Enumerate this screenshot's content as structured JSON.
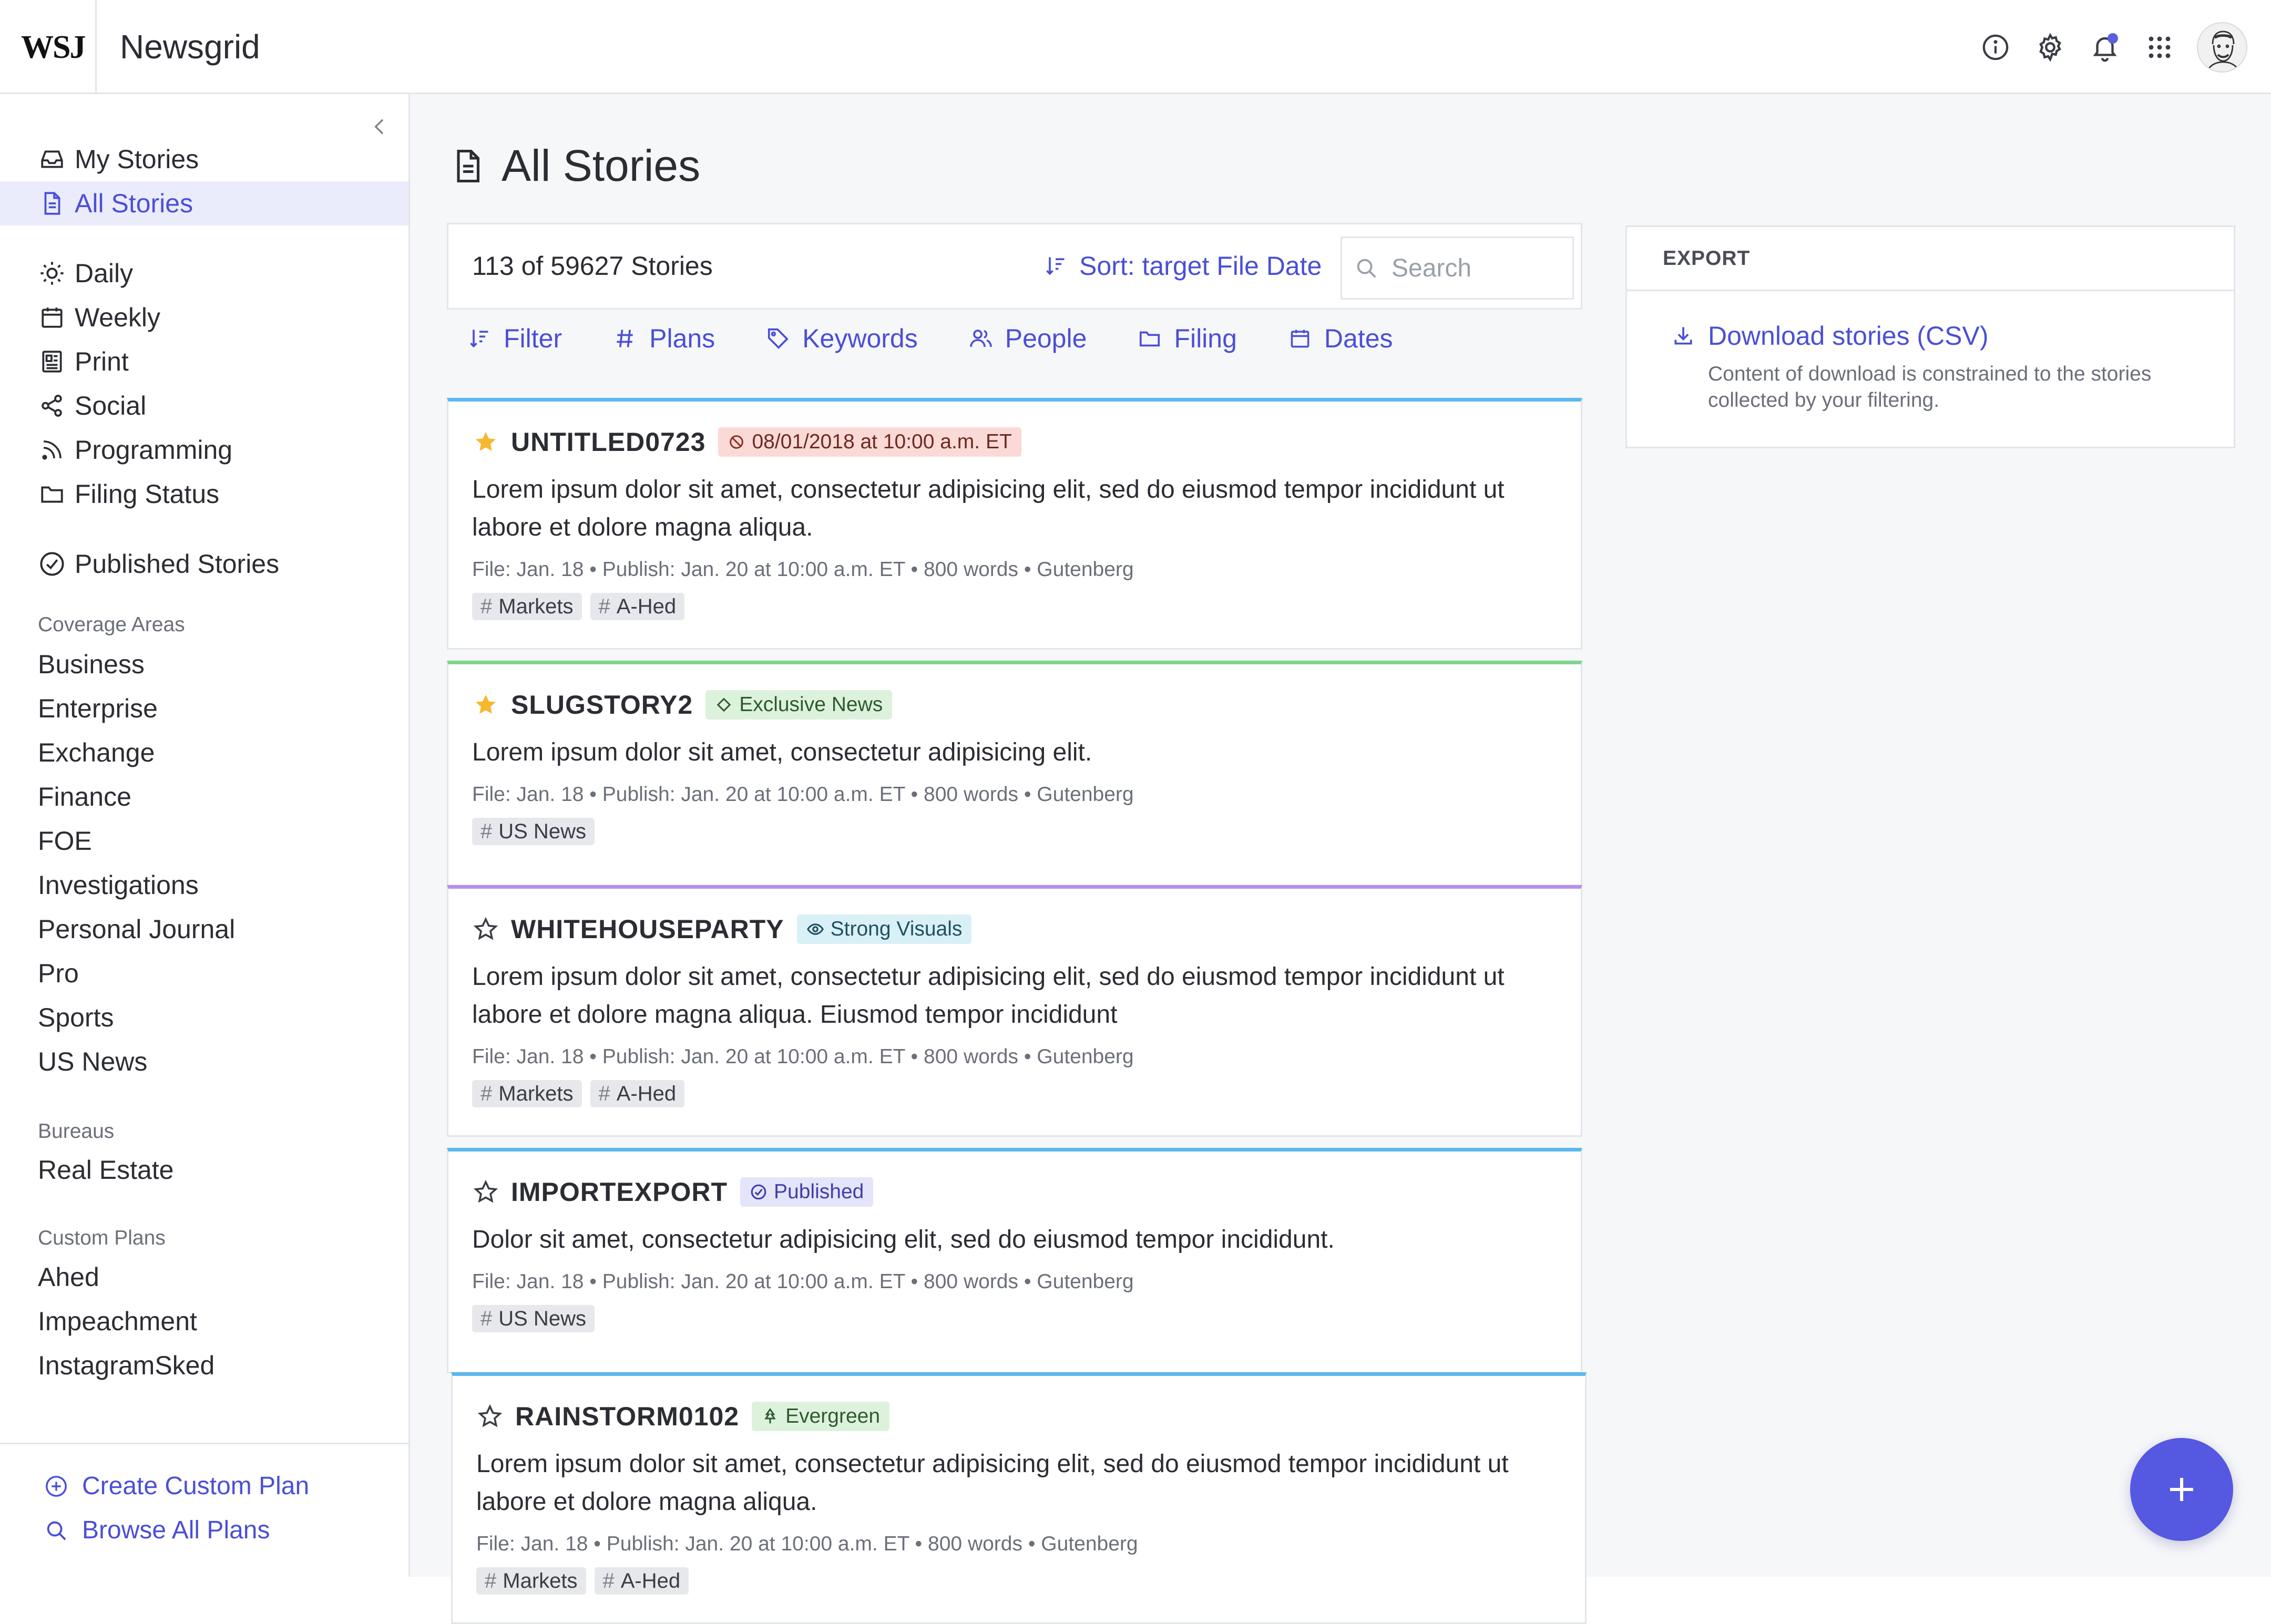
{
  "topbar": {
    "logo": "WSJ",
    "app_title": "Newsgrid",
    "icons": [
      "info-icon",
      "gear-icon",
      "bell-icon",
      "apps-grid-icon",
      "avatar"
    ]
  },
  "sidebar": {
    "main_nav": [
      {
        "label": "My Stories",
        "icon": "inbox-icon"
      },
      {
        "label": "All Stories",
        "icon": "document-icon",
        "active": true
      }
    ],
    "views": [
      {
        "label": "Daily",
        "icon": "sun-icon"
      },
      {
        "label": "Weekly",
        "icon": "calendar-icon"
      },
      {
        "label": "Print",
        "icon": "newspaper-icon"
      },
      {
        "label": "Social",
        "icon": "share-icon"
      },
      {
        "label": "Programming",
        "icon": "rss-icon"
      },
      {
        "label": "Filing Status",
        "icon": "folder-icon"
      }
    ],
    "published": {
      "label": "Published Stories",
      "icon": "check-circle-icon"
    },
    "coverage_label": "Coverage Areas",
    "coverage": [
      "Business",
      "Enterprise",
      "Exchange",
      "Finance",
      "FOE",
      "Investigations",
      "Personal Journal",
      "Pro",
      "Sports",
      "US News"
    ],
    "bureaus_label": "Bureaus",
    "bureaus": [
      "Real Estate"
    ],
    "custom_label": "Custom Plans",
    "custom": [
      "Ahed",
      "Impeachment",
      "InstagramSked"
    ],
    "footer": {
      "create": "Create Custom Plan",
      "browse": "Browse All Plans"
    }
  },
  "main": {
    "title": "All Stories",
    "count": "113 of 59627 Stories",
    "sort": "Sort: target File Date",
    "search_placeholder": "Search",
    "filters": [
      {
        "label": "Filter",
        "icon": "sort-icon"
      },
      {
        "label": "Plans",
        "icon": "hash-icon"
      },
      {
        "label": "Keywords",
        "icon": "tag-icon"
      },
      {
        "label": "People",
        "icon": "people-icon"
      },
      {
        "label": "Filing",
        "icon": "folder-icon"
      },
      {
        "label": "Dates",
        "icon": "calendar-icon"
      }
    ],
    "stories": [
      {
        "slug": "UNTITLED0723",
        "starred": true,
        "badge": {
          "label": "08/01/2018 at 10:00 a.m. ET",
          "icon": "blocked-icon",
          "bg": "#fbd9d6",
          "fg": "#6b2a23"
        },
        "accent": "#5bb8ec",
        "summary": "Lorem ipsum dolor sit amet, consectetur adipisicing elit, sed do eiusmod tempor incididunt ut labore et dolore magna aliqua.",
        "meta": "File: Jan. 18 • Publish: Jan. 20 at 10:00 a.m. ET • 800 words • Gutenberg",
        "tags": [
          "Markets",
          "A-Hed"
        ]
      },
      {
        "slug": "SLUGSTORY2",
        "starred": true,
        "badge": {
          "label": "Exclusive News",
          "icon": "diamond-icon",
          "bg": "#ddf2dd",
          "fg": "#2e5a2e"
        },
        "accent": "#7fd68a",
        "summary": "Lorem ipsum dolor sit amet, consectetur adipisicing elit.",
        "meta": "File: Jan. 18 • Publish: Jan. 20 at 10:00 a.m. ET • 800 words • Gutenberg",
        "tags": [
          "US News"
        ]
      },
      {
        "slug": "WHITEHOUSEPARTY",
        "starred": false,
        "badge": {
          "label": "Strong Visuals",
          "icon": "eye-icon",
          "bg": "#d9f0f7",
          "fg": "#22505e"
        },
        "accent": "#b690e8",
        "summary": "Lorem ipsum dolor sit amet, consectetur adipisicing elit, sed do eiusmod tempor incididunt ut labore et dolore magna aliqua. Eiusmod tempor incididunt",
        "meta": "File: Jan. 18 • Publish: Jan. 20 at 10:00 a.m. ET • 800 words • Gutenberg",
        "tags": [
          "Markets",
          "A-Hed"
        ]
      },
      {
        "slug": "IMPORTEXPORT",
        "starred": false,
        "badge": {
          "label": "Published",
          "icon": "check-circle-icon",
          "bg": "#e4e4fa",
          "fg": "#3f3fa6"
        },
        "accent": "#5bb8ec",
        "summary": "Dolor sit amet, consectetur adipisicing elit, sed do eiusmod tempor incididunt.",
        "meta": "File: Jan. 18 • Publish: Jan. 20 at 10:00 a.m. ET • 800 words • Gutenberg",
        "tags": [
          "US News"
        ]
      },
      {
        "slug": "RAINSTORM0102",
        "starred": false,
        "badge": {
          "label": "Evergreen",
          "icon": "tree-icon",
          "bg": "#ddf2dd",
          "fg": "#2e5a2e"
        },
        "accent": "#5bb8ec",
        "summary": "Lorem ipsum dolor sit amet, consectetur adipisicing elit, sed do eiusmod tempor incididunt ut labore et dolore magna aliqua.",
        "meta": "File: Jan. 18 • Publish: Jan. 20 at 10:00 a.m. ET • 800 words • Gutenberg",
        "tags": [
          "Markets",
          "A-Hed"
        ]
      }
    ]
  },
  "export": {
    "heading": "EXPORT",
    "link": "Download stories (CSV)",
    "note": "Content of download is constrained to the stories collected by your filtering."
  },
  "colors": {
    "accent": "#4b4fd6",
    "fab": "#5558e0",
    "star_filled": "#f5b82e"
  }
}
